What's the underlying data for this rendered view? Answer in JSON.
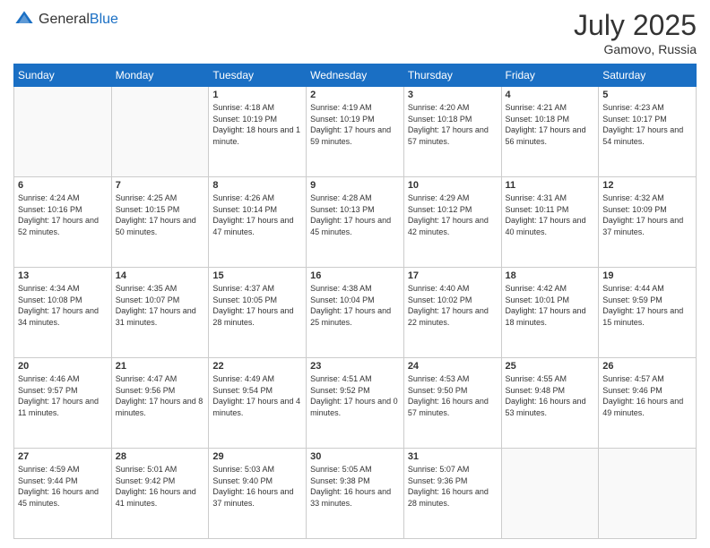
{
  "header": {
    "logo_general": "General",
    "logo_blue": "Blue",
    "month": "July 2025",
    "location": "Gamovo, Russia"
  },
  "weekdays": [
    "Sunday",
    "Monday",
    "Tuesday",
    "Wednesday",
    "Thursday",
    "Friday",
    "Saturday"
  ],
  "weeks": [
    [
      {
        "day": "",
        "info": ""
      },
      {
        "day": "",
        "info": ""
      },
      {
        "day": "1",
        "info": "Sunrise: 4:18 AM\nSunset: 10:19 PM\nDaylight: 18 hours and 1 minute."
      },
      {
        "day": "2",
        "info": "Sunrise: 4:19 AM\nSunset: 10:19 PM\nDaylight: 17 hours and 59 minutes."
      },
      {
        "day": "3",
        "info": "Sunrise: 4:20 AM\nSunset: 10:18 PM\nDaylight: 17 hours and 57 minutes."
      },
      {
        "day": "4",
        "info": "Sunrise: 4:21 AM\nSunset: 10:18 PM\nDaylight: 17 hours and 56 minutes."
      },
      {
        "day": "5",
        "info": "Sunrise: 4:23 AM\nSunset: 10:17 PM\nDaylight: 17 hours and 54 minutes."
      }
    ],
    [
      {
        "day": "6",
        "info": "Sunrise: 4:24 AM\nSunset: 10:16 PM\nDaylight: 17 hours and 52 minutes."
      },
      {
        "day": "7",
        "info": "Sunrise: 4:25 AM\nSunset: 10:15 PM\nDaylight: 17 hours and 50 minutes."
      },
      {
        "day": "8",
        "info": "Sunrise: 4:26 AM\nSunset: 10:14 PM\nDaylight: 17 hours and 47 minutes."
      },
      {
        "day": "9",
        "info": "Sunrise: 4:28 AM\nSunset: 10:13 PM\nDaylight: 17 hours and 45 minutes."
      },
      {
        "day": "10",
        "info": "Sunrise: 4:29 AM\nSunset: 10:12 PM\nDaylight: 17 hours and 42 minutes."
      },
      {
        "day": "11",
        "info": "Sunrise: 4:31 AM\nSunset: 10:11 PM\nDaylight: 17 hours and 40 minutes."
      },
      {
        "day": "12",
        "info": "Sunrise: 4:32 AM\nSunset: 10:09 PM\nDaylight: 17 hours and 37 minutes."
      }
    ],
    [
      {
        "day": "13",
        "info": "Sunrise: 4:34 AM\nSunset: 10:08 PM\nDaylight: 17 hours and 34 minutes."
      },
      {
        "day": "14",
        "info": "Sunrise: 4:35 AM\nSunset: 10:07 PM\nDaylight: 17 hours and 31 minutes."
      },
      {
        "day": "15",
        "info": "Sunrise: 4:37 AM\nSunset: 10:05 PM\nDaylight: 17 hours and 28 minutes."
      },
      {
        "day": "16",
        "info": "Sunrise: 4:38 AM\nSunset: 10:04 PM\nDaylight: 17 hours and 25 minutes."
      },
      {
        "day": "17",
        "info": "Sunrise: 4:40 AM\nSunset: 10:02 PM\nDaylight: 17 hours and 22 minutes."
      },
      {
        "day": "18",
        "info": "Sunrise: 4:42 AM\nSunset: 10:01 PM\nDaylight: 17 hours and 18 minutes."
      },
      {
        "day": "19",
        "info": "Sunrise: 4:44 AM\nSunset: 9:59 PM\nDaylight: 17 hours and 15 minutes."
      }
    ],
    [
      {
        "day": "20",
        "info": "Sunrise: 4:46 AM\nSunset: 9:57 PM\nDaylight: 17 hours and 11 minutes."
      },
      {
        "day": "21",
        "info": "Sunrise: 4:47 AM\nSunset: 9:56 PM\nDaylight: 17 hours and 8 minutes."
      },
      {
        "day": "22",
        "info": "Sunrise: 4:49 AM\nSunset: 9:54 PM\nDaylight: 17 hours and 4 minutes."
      },
      {
        "day": "23",
        "info": "Sunrise: 4:51 AM\nSunset: 9:52 PM\nDaylight: 17 hours and 0 minutes."
      },
      {
        "day": "24",
        "info": "Sunrise: 4:53 AM\nSunset: 9:50 PM\nDaylight: 16 hours and 57 minutes."
      },
      {
        "day": "25",
        "info": "Sunrise: 4:55 AM\nSunset: 9:48 PM\nDaylight: 16 hours and 53 minutes."
      },
      {
        "day": "26",
        "info": "Sunrise: 4:57 AM\nSunset: 9:46 PM\nDaylight: 16 hours and 49 minutes."
      }
    ],
    [
      {
        "day": "27",
        "info": "Sunrise: 4:59 AM\nSunset: 9:44 PM\nDaylight: 16 hours and 45 minutes."
      },
      {
        "day": "28",
        "info": "Sunrise: 5:01 AM\nSunset: 9:42 PM\nDaylight: 16 hours and 41 minutes."
      },
      {
        "day": "29",
        "info": "Sunrise: 5:03 AM\nSunset: 9:40 PM\nDaylight: 16 hours and 37 minutes."
      },
      {
        "day": "30",
        "info": "Sunrise: 5:05 AM\nSunset: 9:38 PM\nDaylight: 16 hours and 33 minutes."
      },
      {
        "day": "31",
        "info": "Sunrise: 5:07 AM\nSunset: 9:36 PM\nDaylight: 16 hours and 28 minutes."
      },
      {
        "day": "",
        "info": ""
      },
      {
        "day": "",
        "info": ""
      }
    ]
  ]
}
